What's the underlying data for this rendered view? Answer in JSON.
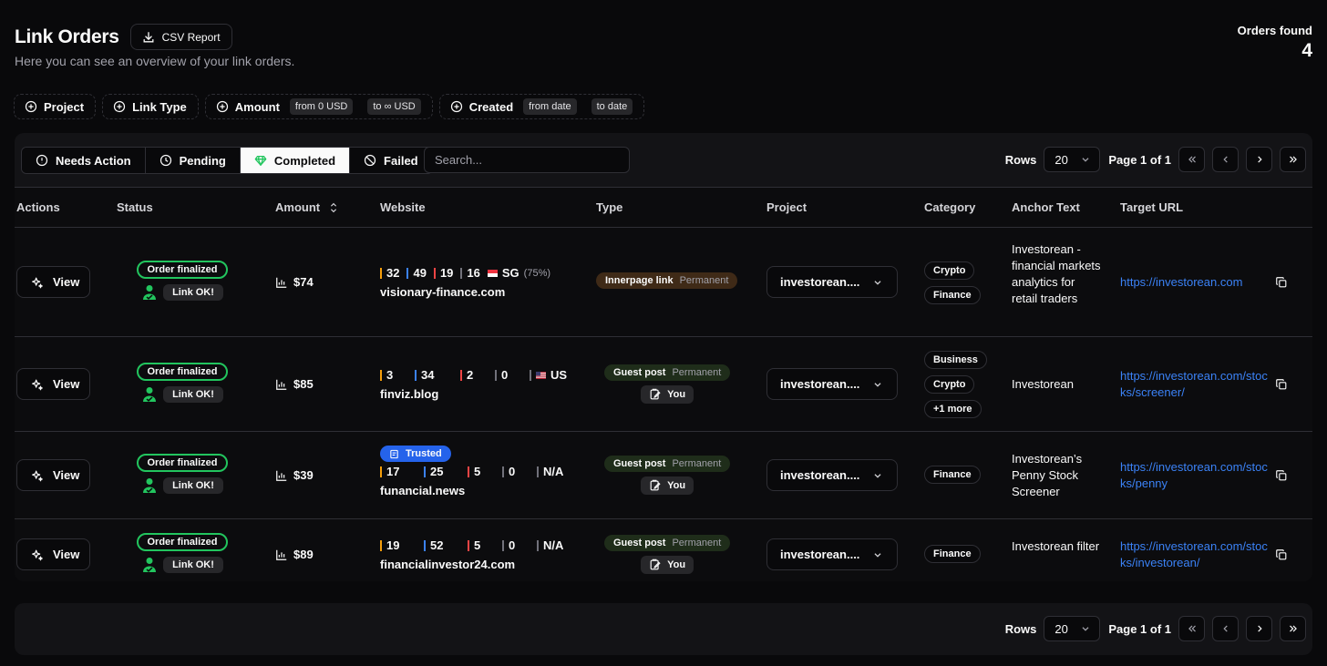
{
  "header": {
    "title": "Link Orders",
    "csv_label": "CSV Report",
    "subtitle": "Here you can see an overview of your link orders.",
    "orders_found_label": "Orders found",
    "orders_found_count": "4"
  },
  "filters": {
    "project": "Project",
    "link_type": "Link Type",
    "amount": "Amount",
    "amount_from": "from 0 USD",
    "amount_to": "to ∞ USD",
    "created": "Created",
    "created_from": "from date",
    "created_to": "to date"
  },
  "tabs": {
    "needs_action": "Needs Action",
    "pending": "Pending",
    "completed": "Completed",
    "failed": "Failed",
    "active": "completed"
  },
  "search": {
    "placeholder": "Search..."
  },
  "pagination": {
    "rows_label": "Rows",
    "rows_value": "20",
    "page_text": "Page 1 of 1"
  },
  "columns": {
    "actions": "Actions",
    "status": "Status",
    "amount": "Amount",
    "website": "Website",
    "type": "Type",
    "project": "Project",
    "category": "Category",
    "anchor": "Anchor Text",
    "target": "Target URL"
  },
  "colors": {
    "metric_1": "#f59e0b",
    "metric_2": "#3b82f6",
    "metric_3": "#ef4444",
    "metric_4": "#71717a",
    "status_green": "#22c55e",
    "link_blue": "#3b82f6",
    "innerpage_bg": "#3f2a17",
    "guest_bg": "#1f2d1a"
  },
  "rows": [
    {
      "view_label": "View",
      "status": "Order finalized",
      "link_status": "Link OK!",
      "amount": "$74",
      "metrics": [
        "32",
        "49",
        "19",
        "16"
      ],
      "geo": "SG",
      "geo_pct": "(75%)",
      "domain": "visionary-finance.com",
      "type": "Innerpage link",
      "duration": "Permanent",
      "project": "investorean....",
      "categories": [
        "Crypto",
        "Finance"
      ],
      "anchor": "Investorean - financial markets analytics for retail traders",
      "target": "https://investorean.com"
    },
    {
      "view_label": "View",
      "status": "Order finalized",
      "link_status": "Link OK!",
      "amount": "$85",
      "metrics": [
        "3",
        "34",
        "2",
        "0"
      ],
      "geo": "US",
      "domain": "finviz.blog",
      "type": "Guest post",
      "duration": "Permanent",
      "author": "You",
      "project": "investorean....",
      "categories": [
        "Business",
        "Crypto",
        "+1 more"
      ],
      "anchor": "Investorean",
      "target": "https://investorean.com/stocks/screener/"
    },
    {
      "view_label": "View",
      "status": "Order finalized",
      "link_status": "Link OK!",
      "amount": "$39",
      "trusted": "Trusted",
      "metrics": [
        "17",
        "25",
        "5",
        "0"
      ],
      "geo": "N/A",
      "domain": "funancial.news",
      "type": "Guest post",
      "duration": "Permanent",
      "author": "You",
      "project": "investorean....",
      "categories": [
        "Finance"
      ],
      "anchor": "Investorean’s Penny Stock Screener",
      "target": "https://investorean.com/stocks/penny"
    },
    {
      "view_label": "View",
      "status": "Order finalized",
      "link_status": "Link OK!",
      "amount": "$89",
      "metrics": [
        "19",
        "52",
        "5",
        "0"
      ],
      "geo": "N/A",
      "domain": "financialinvestor24.com",
      "type": "Guest post",
      "duration": "Permanent",
      "author": "You",
      "project": "investorean....",
      "categories": [
        "Finance"
      ],
      "anchor": "Investorean filter",
      "target": "https://investorean.com/stocks/investorean/"
    }
  ]
}
